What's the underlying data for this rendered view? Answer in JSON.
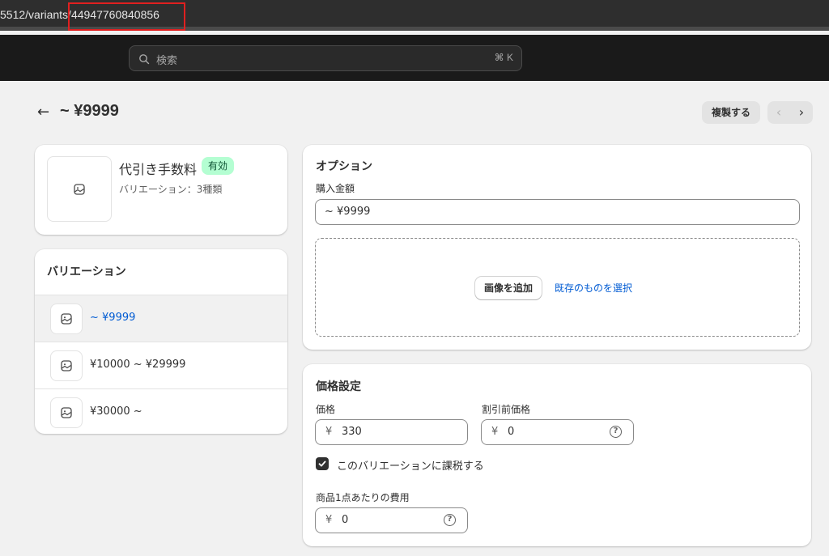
{
  "browser": {
    "url": "5512/variants/44947760840856"
  },
  "topbar": {
    "search_placeholder": "検索",
    "search_shortcut": "⌘ K",
    "search_icon": "search-icon"
  },
  "page": {
    "back_arrow": "←",
    "title": "~ ¥9999",
    "duplicate_label": "複製する",
    "prev_arrow": "‹",
    "next_arrow": "›"
  },
  "product": {
    "name": "代引き手数料",
    "status": "有効",
    "variant_count": "バリエーション：3種類",
    "image_icon": "image-icon"
  },
  "variants": {
    "title": "バリエーション",
    "items": [
      {
        "label": "~ ¥9999",
        "selected": true
      },
      {
        "label": "¥10000 ~ ¥29999",
        "selected": false
      },
      {
        "label": "¥30000 ~",
        "selected": false
      }
    ]
  },
  "options": {
    "title": "オプション",
    "field_label": "購入金額",
    "field_value": "~ ¥9999",
    "add_image_label": "画像を追加",
    "select_existing_label": "既存のものを選択"
  },
  "pricing": {
    "title": "価格設定",
    "price_label": "価格",
    "price_currency": "¥",
    "price_value": "330",
    "compare_label": "割引前価格",
    "compare_currency": "¥",
    "compare_value": "0",
    "taxable_label": "このバリエーションに課税する",
    "taxable_checked": true,
    "cost_label": "商品1点あたりの費用",
    "cost_currency": "¥",
    "cost_value": "0",
    "help_glyph": "?"
  },
  "colors": {
    "link_blue": "#005bd3",
    "badge_green_bg": "#b4fed2",
    "highlight_red": "#e02020"
  }
}
